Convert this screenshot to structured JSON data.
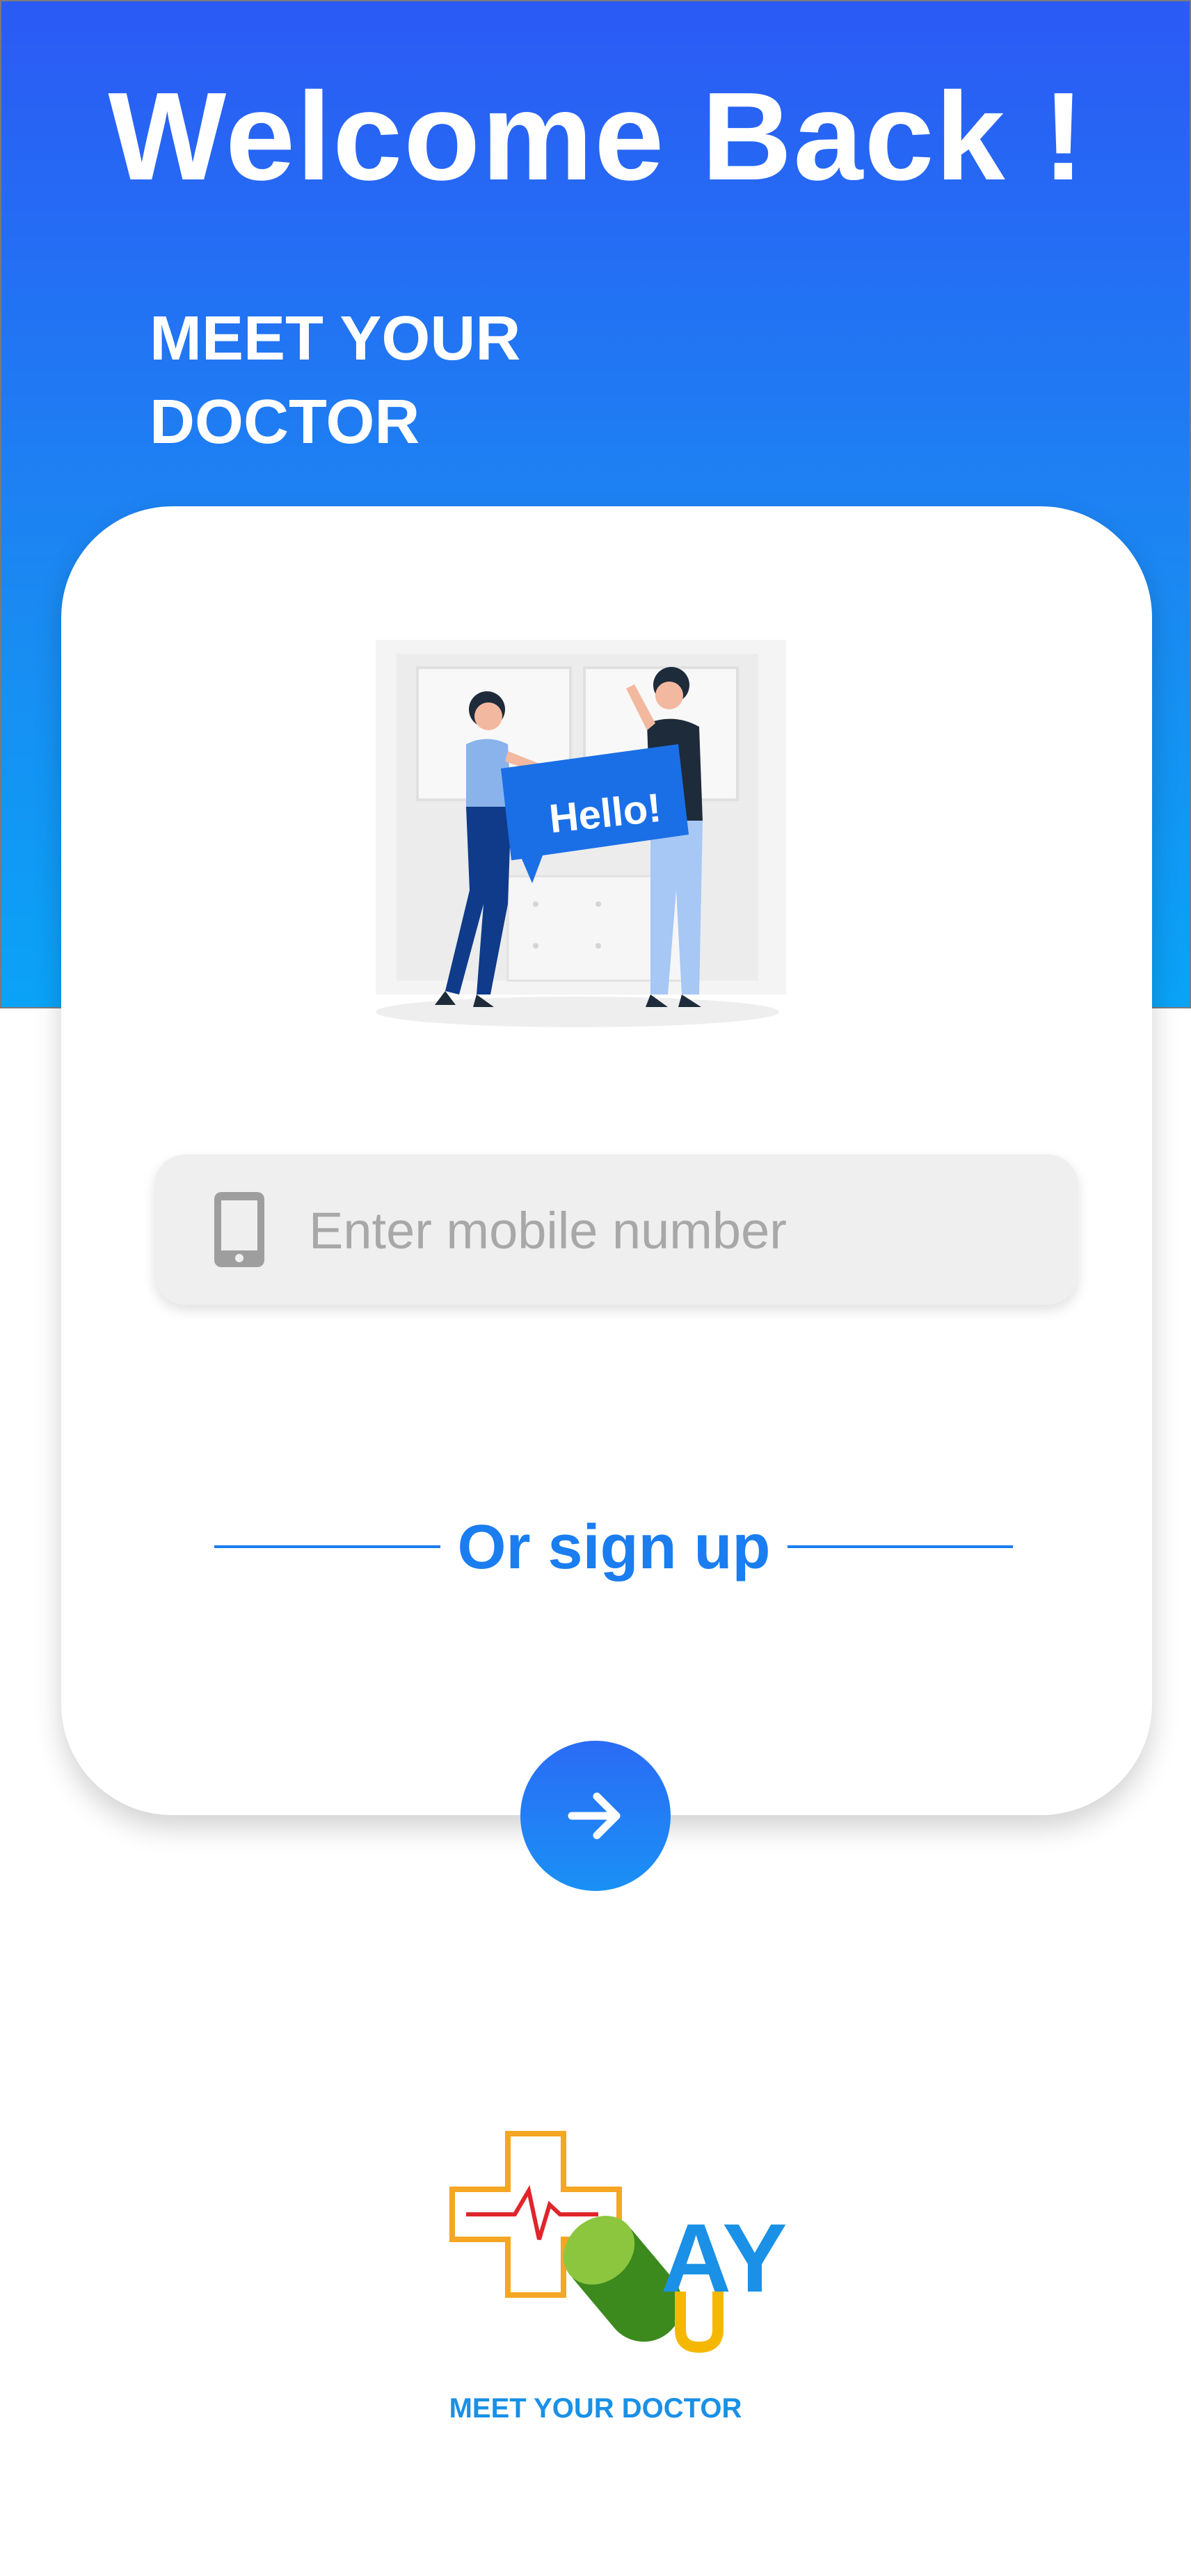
{
  "header": {
    "title": "Welcome Back !",
    "tagline_line1": "MEET YOUR",
    "tagline_line2": "DOCTOR"
  },
  "illustration": {
    "speech_bubble_text": "Hello!"
  },
  "login": {
    "mobile_placeholder": "Enter mobile number",
    "mobile_value": "",
    "phone_icon": "smartphone-icon"
  },
  "signup": {
    "label": "Or sign up"
  },
  "next_button": {
    "icon": "arrow-right-icon"
  },
  "brand": {
    "logo_letters": "AY",
    "caption": "MEET YOUR DOCTOR"
  },
  "colors": {
    "accent": "#1a7df0",
    "header_gradient_top": "#2b5af5",
    "header_gradient_bottom": "#0aa3f7",
    "input_background": "#efefef",
    "placeholder": "#a8a8a8"
  }
}
